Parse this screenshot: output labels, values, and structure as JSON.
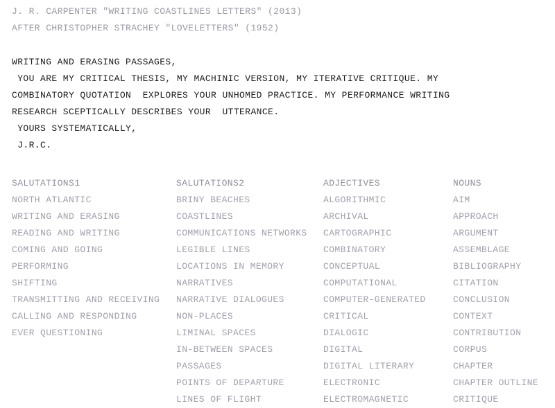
{
  "masthead": {
    "lines": [
      "J. R. CARPENTER \"WRITING COASTLINES LETTERS\" (2013)",
      "AFTER CHRISTOPHER STRACHEY \"LOVELETTERS\" (1952)"
    ]
  },
  "letter": {
    "lines": [
      "WRITING AND ERASING PASSAGES,",
      " YOU ARE MY CRITICAL THESIS, MY MACHINIC VERSION, MY ITERATIVE CRITIQUE. MY",
      "COMBINATORY QUOTATION  EXPLORES YOUR UNHOMED PRACTICE. MY PERFORMANCE WRITING",
      "RESEARCH SCEPTICALLY DESCRIBES YOUR  UTTERANCE.",
      " YOURS SYSTEMATICALLY,",
      " J.R.C."
    ]
  },
  "columns": [
    {
      "header": "SALUTATIONS1",
      "items": [
        "NORTH ATLANTIC",
        "WRITING AND ERASING",
        "READING AND WRITING",
        "COMING AND GOING",
        "PERFORMING",
        "SHIFTING",
        "TRANSMITTING AND RECEIVING",
        "CALLING AND RESPONDING",
        "EVER QUESTIONING"
      ]
    },
    {
      "header": "SALUTATIONS2",
      "items": [
        "BRINY BEACHES",
        "COASTLINES",
        "COMMUNICATIONS NETWORKS",
        "LEGIBLE LINES",
        "LOCATIONS IN MEMORY",
        "NARRATIVES",
        "NARRATIVE DIALOGUES",
        "NON-PLACES",
        "LIMINAL SPACES",
        "IN-BETWEEN SPACES",
        "PASSAGES",
        "POINTS OF DEPARTURE",
        "LINES OF FLIGHT"
      ]
    },
    {
      "header": "ADJECTIVES",
      "items": [
        "ALGORITHMIC",
        "ARCHIVAL",
        "CARTOGRAPHIC",
        "COMBINATORY",
        "CONCEPTUAL",
        "COMPUTATIONAL",
        "COMPUTER-GENERATED",
        "CRITICAL",
        "DIALOGIC",
        "DIGITAL",
        "DIGITAL LITERARY",
        "ELECTRONIC",
        "ELECTROMAGNETIC"
      ]
    },
    {
      "header": "NOUNS",
      "items": [
        "AIM",
        "APPROACH",
        "ARGUMENT",
        "ASSEMBLAGE",
        "BIBLIOGRAPHY",
        "CITATION",
        "CONCLUSION",
        "CONTEXT",
        "CONTRIBUTION",
        "CORPUS",
        "CHAPTER",
        "CHAPTER OUTLINE",
        "CRITIQUE"
      ]
    }
  ],
  "colors": {
    "background": "#ffffff",
    "muted_text": "#9a9aa6",
    "body_text": "#1c1c1c",
    "column_header": "#8f8f9b",
    "column_item": "#a0a0ac"
  }
}
